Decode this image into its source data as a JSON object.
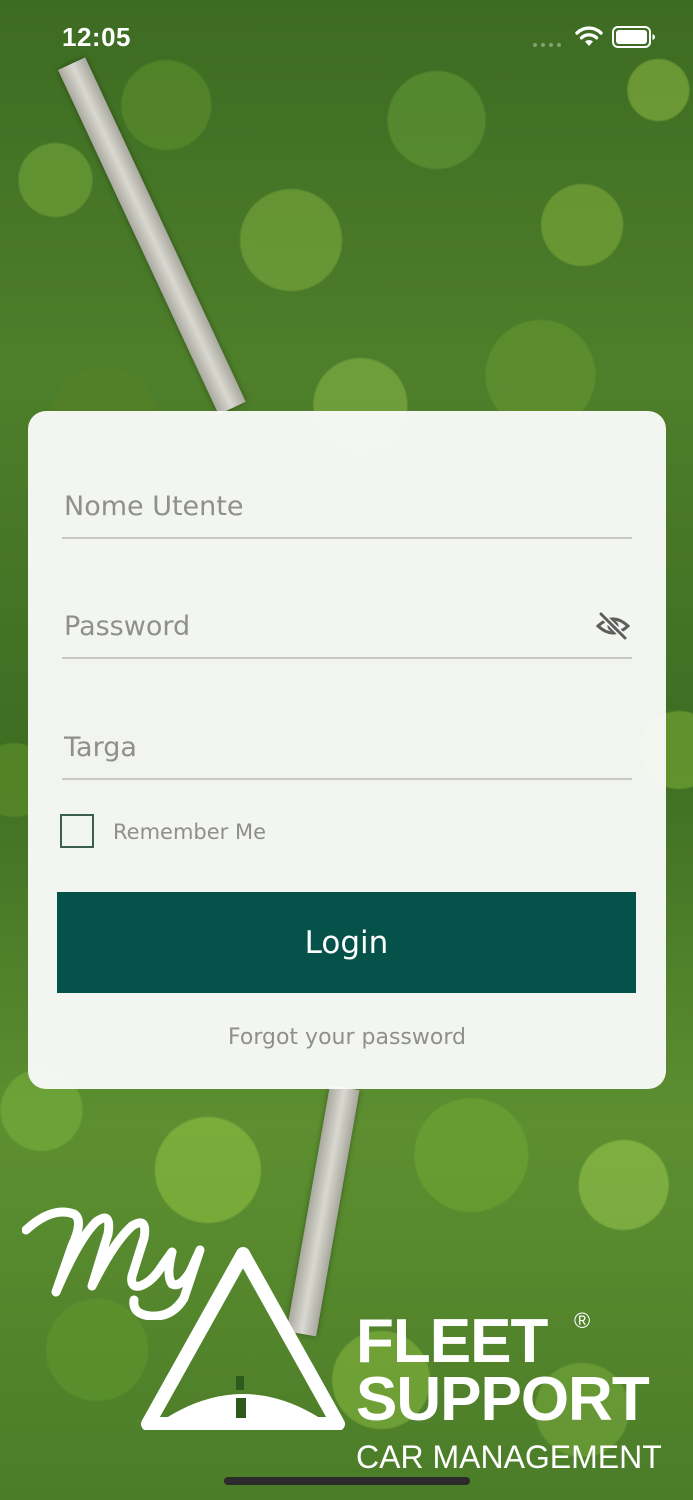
{
  "status_bar": {
    "time": "12:05",
    "icons": [
      "signal-icon",
      "wifi-icon",
      "battery-icon"
    ]
  },
  "login_form": {
    "username_placeholder": "Nome Utente",
    "username_value": "",
    "password_placeholder": "Password",
    "password_value": "",
    "plate_placeholder": "Targa",
    "plate_value": "",
    "password_toggle_icon": "eye-slash-icon",
    "remember_label": "Remember Me",
    "remember_checked": false,
    "login_label": "Login",
    "forgot_label": "Forgot your password"
  },
  "logo": {
    "fleet": "FLEET",
    "registered": "®",
    "support": "SUPPORT",
    "car_management": "CAR MANAGEMENT"
  },
  "colors": {
    "primary": "#05524a",
    "card_background": "#fcfcfb",
    "placeholder": "#8f8f8f",
    "divider": "#c8c8c8"
  }
}
